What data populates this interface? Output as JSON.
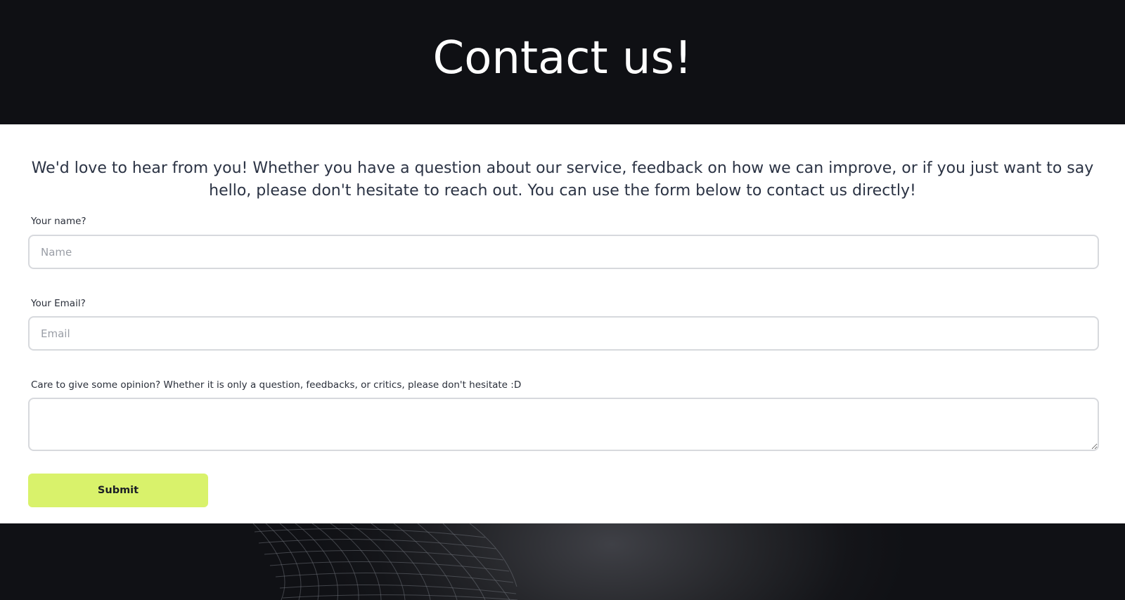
{
  "header": {
    "title": "Contact us!"
  },
  "intro": {
    "text": "We'd love to hear from you! Whether you have a question about our service, feedback on how we can improve, or if you just want to say hello, please don't hesitate to reach out. You can use the form below to contact us directly!"
  },
  "form": {
    "name_label": "Your name?",
    "name_placeholder": "Name",
    "name_value": "",
    "email_label": "Your Email?",
    "email_placeholder": "Email",
    "email_value": "",
    "opinion_label": "Care to give some opinion? Whether it is only a question, feedbacks, or critics, please don't hesitate :D",
    "opinion_value": "",
    "submit_label": "Submit"
  },
  "colors": {
    "header_bg": "#0f1014",
    "submit_bg": "#d9f26b",
    "footer_bg": "#101115"
  },
  "footer": {
    "decoration": "wireframe-mesh-graphic"
  }
}
